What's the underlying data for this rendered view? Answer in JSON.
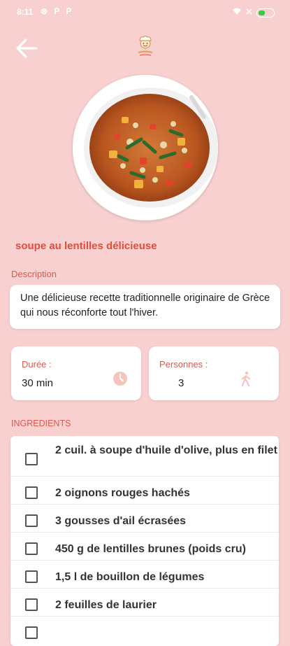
{
  "status_bar": {
    "time": "8:11",
    "left_icons": "⊗ P P",
    "right_icons": "⌔ ✕"
  },
  "recipe": {
    "title": "soupe au lentilles délicieuse",
    "description_label": "Description",
    "description": "Une délicieuse recette traditionnelle originaire de Grèce qui nous réconforte tout l'hiver.",
    "duration_label": "Durée :",
    "duration_value": "30 min",
    "people_label": "Personnes :",
    "people_value": "3",
    "ingredients_label": "INGREDIENTS",
    "ingredients": [
      "2 cuil. à soupe d'huile d'olive, plus en filet",
      "2 oignons rouges hachés",
      "3 gousses d'ail écrasées",
      "450 g de lentilles brunes (poids cru)",
      "1,5 l de bouillon de légumes",
      "2 feuilles de laurier"
    ]
  },
  "icons": {
    "back": "arrow-left-icon",
    "logo": "chef-logo-icon",
    "duration": "clock-icon",
    "people": "walking-person-icon"
  },
  "colors": {
    "background": "#f8d0d0",
    "accent": "#e24c3e",
    "label": "#d9594d",
    "card": "#ffffff"
  }
}
